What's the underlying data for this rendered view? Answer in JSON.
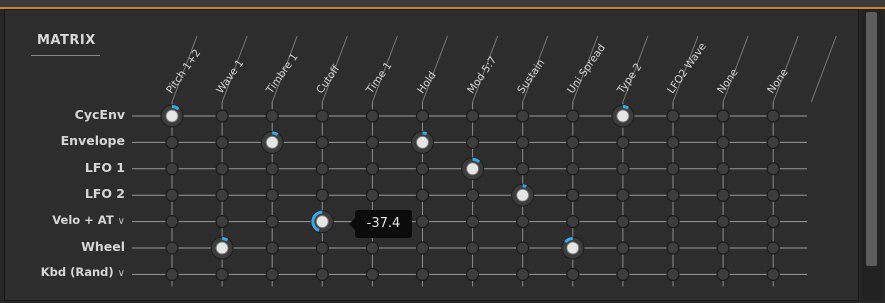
{
  "title": "MATRIX",
  "colors": {
    "accent": "#3aa8e8",
    "orange": "#c8862b"
  },
  "tooltip_value": "-37.4",
  "columns": [
    "Pitch 1+2",
    "Wave 1",
    "Timbre 1",
    "Cutoff",
    "Time 1",
    "Hold",
    "Mod 5:7",
    "Sustain",
    "Uni Spread",
    "Type 2",
    "LFO2 Wave",
    "None",
    "None"
  ],
  "rows": [
    {
      "label": "CycEnv",
      "dropdown": false
    },
    {
      "label": "Envelope",
      "dropdown": false
    },
    {
      "label": "LFO 1",
      "dropdown": false
    },
    {
      "label": "LFO 2",
      "dropdown": false
    },
    {
      "label": "Velo + AT",
      "dropdown": true
    },
    {
      "label": "Wheel",
      "dropdown": false
    },
    {
      "label": "Kbd (Rand)",
      "dropdown": true
    }
  ],
  "active_knobs": [
    {
      "row": 0,
      "col": 0,
      "amount": 0.1
    },
    {
      "row": 0,
      "col": 9,
      "amount": 0.08
    },
    {
      "row": 1,
      "col": 2,
      "amount": 0.08
    },
    {
      "row": 1,
      "col": 5,
      "amount": 0.06
    },
    {
      "row": 2,
      "col": 6,
      "amount": 0.1
    },
    {
      "row": 3,
      "col": 7,
      "amount": 0.05
    },
    {
      "row": 4,
      "col": 3,
      "amount": -0.37
    },
    {
      "row": 5,
      "col": 1,
      "amount": 0.08
    },
    {
      "row": 5,
      "col": 8,
      "amount": -0.12
    }
  ]
}
